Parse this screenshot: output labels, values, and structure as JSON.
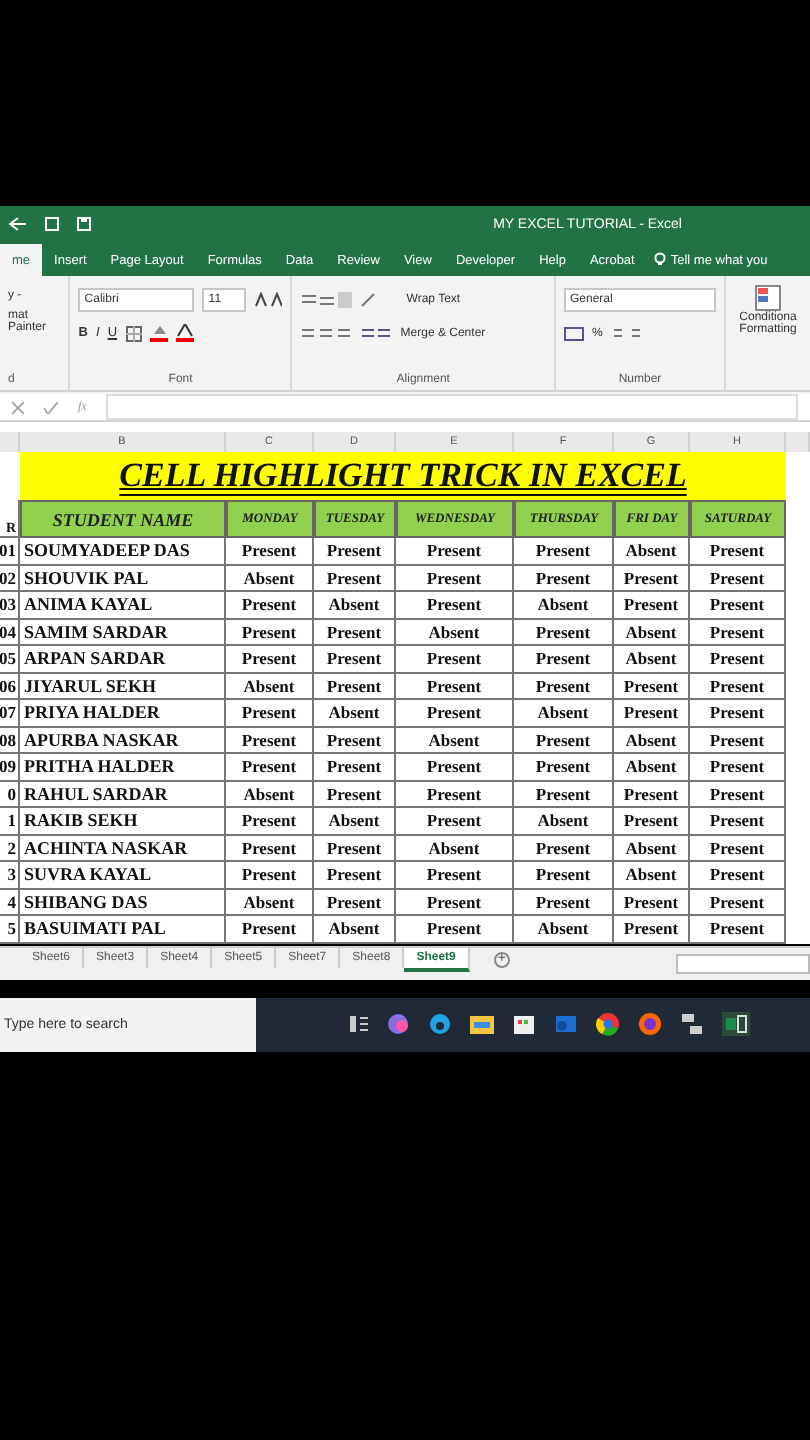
{
  "window": {
    "title": "MY EXCEL TUTORIAL  -  Excel"
  },
  "ribbon_tabs": [
    {
      "label": "me",
      "selected": true
    },
    {
      "label": "Insert",
      "selected": false
    },
    {
      "label": "Page Layout",
      "selected": false
    },
    {
      "label": "Formulas",
      "selected": false
    },
    {
      "label": "Data",
      "selected": false
    },
    {
      "label": "Review",
      "selected": false
    },
    {
      "label": "View",
      "selected": false
    },
    {
      "label": "Developer",
      "selected": false
    },
    {
      "label": "Help",
      "selected": false
    },
    {
      "label": "Acrobat",
      "selected": false
    }
  ],
  "tell_me": "Tell me what you",
  "clipboard": {
    "items": [
      "y  -",
      "mat Painter"
    ],
    "label": "d"
  },
  "font": {
    "name": "Calibri",
    "size": "11",
    "styles": [
      "B",
      "I",
      "U"
    ],
    "label": "Font"
  },
  "alignment": {
    "wrap": "Wrap Text",
    "merge": "Merge & Center",
    "label": "Alignment"
  },
  "number": {
    "format": "General",
    "percent": "%",
    "label": "Number"
  },
  "conditional": "Conditiona Formatting",
  "formula_bar": {
    "fx": "fx"
  },
  "columns": [
    "B",
    "C",
    "D",
    "E",
    "F",
    "G",
    "H"
  ],
  "sheet_title": "CELL HIGHLIGHT TRICK IN EXCEL",
  "header": {
    "row_label": "R",
    "cells": [
      "STUDENT NAME",
      "MONDAY",
      "TUESDAY",
      "WEDNESDAY",
      "THURSDAY",
      "FRI DAY",
      "SATURDAY"
    ]
  },
  "rows": [
    {
      "num": "01",
      "cells": [
        "SOUMYADEEP DAS",
        "Present",
        "Present",
        "Present",
        "Present",
        "Absent",
        "Present"
      ]
    },
    {
      "num": "02",
      "cells": [
        "SHOUVIK PAL",
        "Absent",
        "Present",
        "Present",
        "Present",
        "Present",
        "Present"
      ]
    },
    {
      "num": "03",
      "cells": [
        "ANIMA KAYAL",
        "Present",
        "Absent",
        "Present",
        "Absent",
        "Present",
        "Present"
      ]
    },
    {
      "num": "04",
      "cells": [
        "SAMIM SARDAR",
        "Present",
        "Present",
        "Absent",
        "Present",
        "Absent",
        "Present"
      ]
    },
    {
      "num": "05",
      "cells": [
        "ARPAN SARDAR",
        "Present",
        "Present",
        "Present",
        "Present",
        "Absent",
        "Present"
      ]
    },
    {
      "num": "06",
      "cells": [
        "JIYARUL SEKH",
        "Absent",
        "Present",
        "Present",
        "Present",
        "Present",
        "Present"
      ]
    },
    {
      "num": "07",
      "cells": [
        "PRIYA HALDER",
        "Present",
        "Absent",
        "Present",
        "Absent",
        "Present",
        "Present"
      ]
    },
    {
      "num": "08",
      "cells": [
        "APURBA NASKAR",
        "Present",
        "Present",
        "Absent",
        "Present",
        "Absent",
        "Present"
      ]
    },
    {
      "num": "09",
      "cells": [
        "PRITHA HALDER",
        "Present",
        "Present",
        "Present",
        "Present",
        "Absent",
        "Present"
      ]
    },
    {
      "num": "0",
      "cells": [
        "RAHUL SARDAR",
        "Absent",
        "Present",
        "Present",
        "Present",
        "Present",
        "Present"
      ]
    },
    {
      "num": "1",
      "cells": [
        "RAKIB SEKH",
        "Present",
        "Absent",
        "Present",
        "Absent",
        "Present",
        "Present"
      ]
    },
    {
      "num": "2",
      "cells": [
        "ACHINTA NASKAR",
        "Present",
        "Present",
        "Absent",
        "Present",
        "Absent",
        "Present"
      ]
    },
    {
      "num": "3",
      "cells": [
        "SUVRA KAYAL",
        "Present",
        "Present",
        "Present",
        "Present",
        "Absent",
        "Present"
      ]
    },
    {
      "num": "4",
      "cells": [
        "SHIBANG DAS",
        "Absent",
        "Present",
        "Present",
        "Present",
        "Present",
        "Present"
      ]
    },
    {
      "num": "5",
      "cells": [
        "BASUIMATI  PAL",
        "Present",
        "Absent",
        "Present",
        "Absent",
        "Present",
        "Present"
      ]
    }
  ],
  "sheet_tabs": [
    {
      "label": "Sheet6",
      "selected": false
    },
    {
      "label": "Sheet3",
      "selected": false
    },
    {
      "label": "Sheet4",
      "selected": false
    },
    {
      "label": "Sheet5",
      "selected": false
    },
    {
      "label": "Sheet7",
      "selected": false
    },
    {
      "label": "Sheet8",
      "selected": false
    },
    {
      "label": "Sheet9",
      "selected": true
    }
  ],
  "add_sheet": "+",
  "taskbar": {
    "search_placeholder": "Type here to search"
  }
}
